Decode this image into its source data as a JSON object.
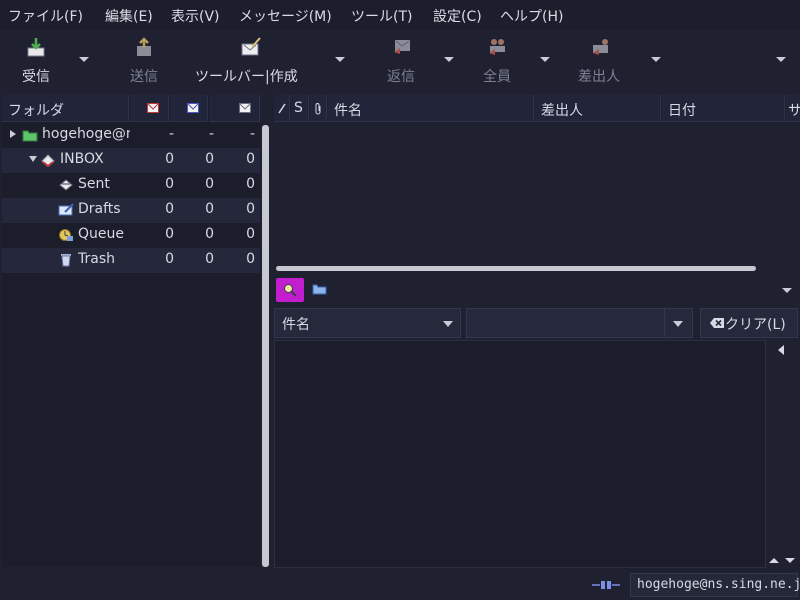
{
  "menubar": {
    "items": [
      "ファイル(F)",
      "編集(E)",
      "表示(V)",
      "メッセージ(M)",
      "ツール(T)",
      "設定(C)",
      "ヘルプ(H)"
    ]
  },
  "toolbar": {
    "receive_label": "受信",
    "send_label": "送信",
    "compose_label": "ツールバー|作成",
    "reply_label": "返信",
    "reply_all_label": "全員",
    "sender_label": "差出人"
  },
  "folder_pane": {
    "header_label": "フォルダ",
    "rows": [
      {
        "name": "hogehoge@n",
        "new": "-",
        "unread": "-",
        "total": "-"
      },
      {
        "name": "INBOX",
        "new": "0",
        "unread": "0",
        "total": "0"
      },
      {
        "name": "Sent",
        "new": "0",
        "unread": "0",
        "total": "0"
      },
      {
        "name": "Drafts",
        "new": "0",
        "unread": "0",
        "total": "0"
      },
      {
        "name": "Queue",
        "new": "0",
        "unread": "0",
        "total": "0"
      },
      {
        "name": "Trash",
        "new": "0",
        "unread": "0",
        "total": "0"
      }
    ]
  },
  "message_list": {
    "col_s": "S",
    "col_subject": "件名",
    "col_from": "差出人",
    "col_date": "日付",
    "col_size": "サ"
  },
  "search": {
    "field_label": "件名",
    "query_value": "",
    "clear_label": "クリア(L)"
  },
  "statusbar": {
    "account": "hogehoge@ns.sing.ne.jp"
  },
  "colors": {
    "background": "#1f2131",
    "search_button": "#c21ed0",
    "accent_folder": "#6fd17a"
  }
}
